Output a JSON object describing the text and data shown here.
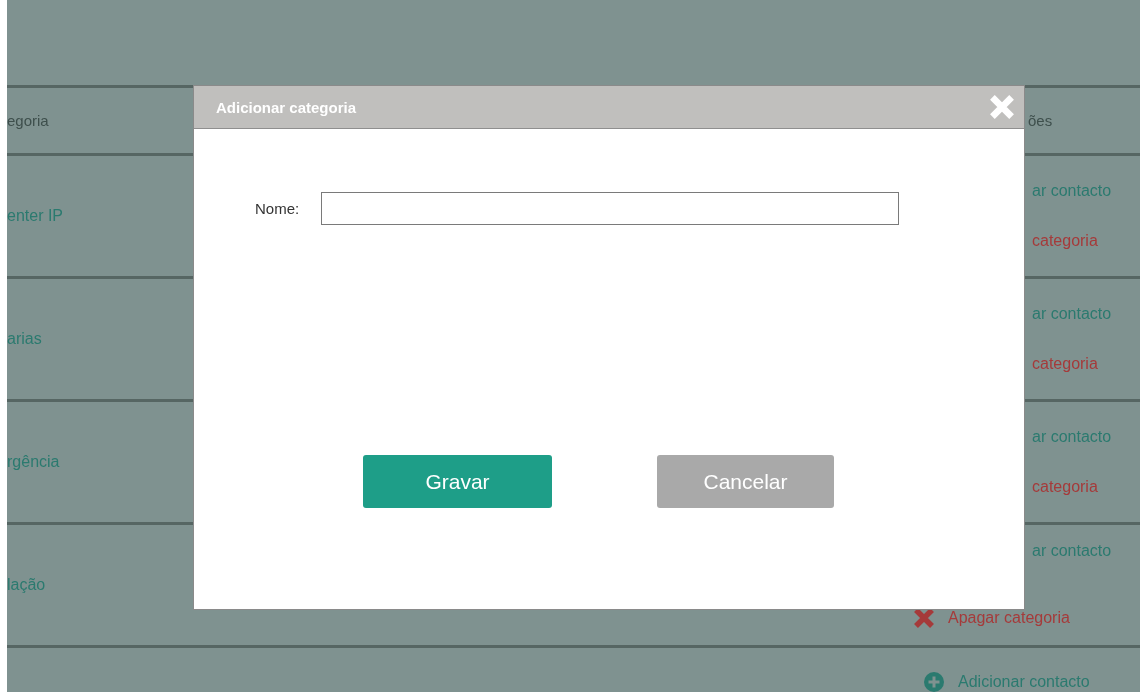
{
  "table": {
    "columns": [
      {
        "label": "egoria"
      },
      {
        "label": "ões"
      }
    ],
    "rows": [
      {
        "name": "enter IP",
        "actions": [
          {
            "kind": "partial",
            "label": "ar contacto",
            "color": "#2b7a6f"
          },
          {
            "kind": "partial",
            "label": "categoria",
            "color": "#a53a3a"
          }
        ]
      },
      {
        "name": "arias",
        "actions": [
          {
            "kind": "partial",
            "label": "ar contacto",
            "color": "#2b7a6f"
          },
          {
            "kind": "partial",
            "label": "categoria",
            "color": "#a53a3a"
          }
        ]
      },
      {
        "name": "rgência",
        "actions": [
          {
            "kind": "partial",
            "label": "ar contacto",
            "color": "#2b7a6f"
          },
          {
            "kind": "partial",
            "label": "categoria",
            "color": "#a53a3a"
          }
        ]
      },
      {
        "name": "lação",
        "actions": [
          {
            "kind": "partial",
            "label": "ar contacto",
            "color": "#2b7a6f"
          },
          {
            "kind": "delete",
            "label": "Apagar categoria",
            "color": "#a53a3a"
          }
        ]
      }
    ],
    "footer_action": {
      "kind": "add",
      "label": "Adicionar contacto",
      "color": "#2b7a6f"
    }
  },
  "dialog": {
    "title": "Adicionar categoria",
    "field": {
      "label": "Nome:"
    },
    "buttons": [
      {
        "kind": "primary",
        "label": "Gravar"
      },
      {
        "kind": "secondary",
        "label": "Cancelar"
      }
    ]
  }
}
